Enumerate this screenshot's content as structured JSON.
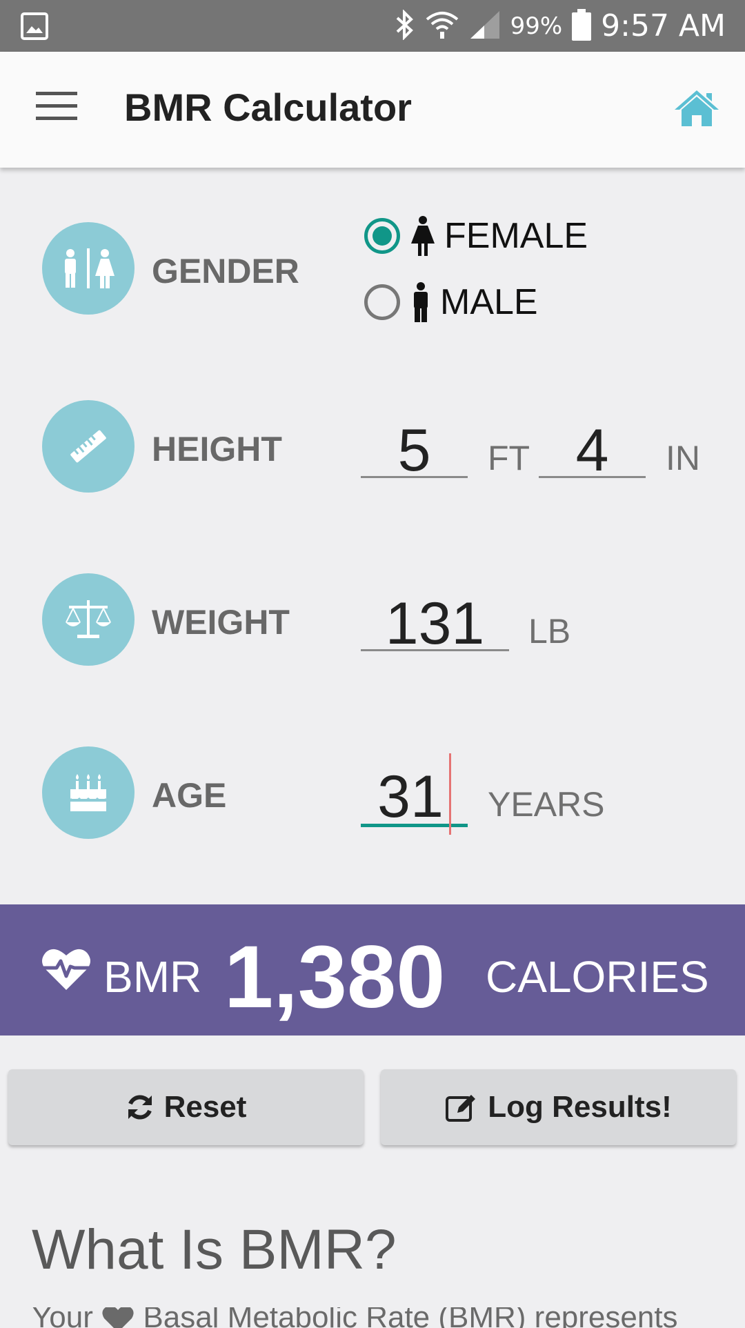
{
  "status_bar": {
    "battery": "99%",
    "time": "9:57 AM",
    "icons": [
      "image-icon",
      "bluetooth-icon",
      "wifi-icon",
      "signal-icon",
      "battery-icon"
    ]
  },
  "app_bar": {
    "title": "BMR Calculator",
    "icons": [
      "menu-icon",
      "home-icon"
    ],
    "accent_color": "#5bbfd3"
  },
  "form": {
    "gender": {
      "label": "GENDER",
      "options": [
        {
          "label": "FEMALE",
          "selected": true
        },
        {
          "label": "MALE",
          "selected": false
        }
      ]
    },
    "height": {
      "label": "HEIGHT",
      "feet": "5",
      "feet_unit": "FT",
      "inches": "4",
      "inches_unit": "IN"
    },
    "weight": {
      "label": "WEIGHT",
      "value": "131",
      "unit": "LB"
    },
    "age": {
      "label": "AGE",
      "value": "31",
      "unit": "YEARS"
    }
  },
  "result": {
    "label": "BMR",
    "value": "1,380",
    "unit": "CALORIES",
    "color": "#665c97"
  },
  "buttons": {
    "reset": "Reset",
    "log": "Log Results!"
  },
  "info": {
    "title": "What Is BMR?",
    "body_before": "Your",
    "body_after": "Basal Metabolic Rate (BMR) represents"
  },
  "colors": {
    "icon_circle": "#8ccbd6",
    "radio_checked": "#109688",
    "caret": "#e57373"
  }
}
